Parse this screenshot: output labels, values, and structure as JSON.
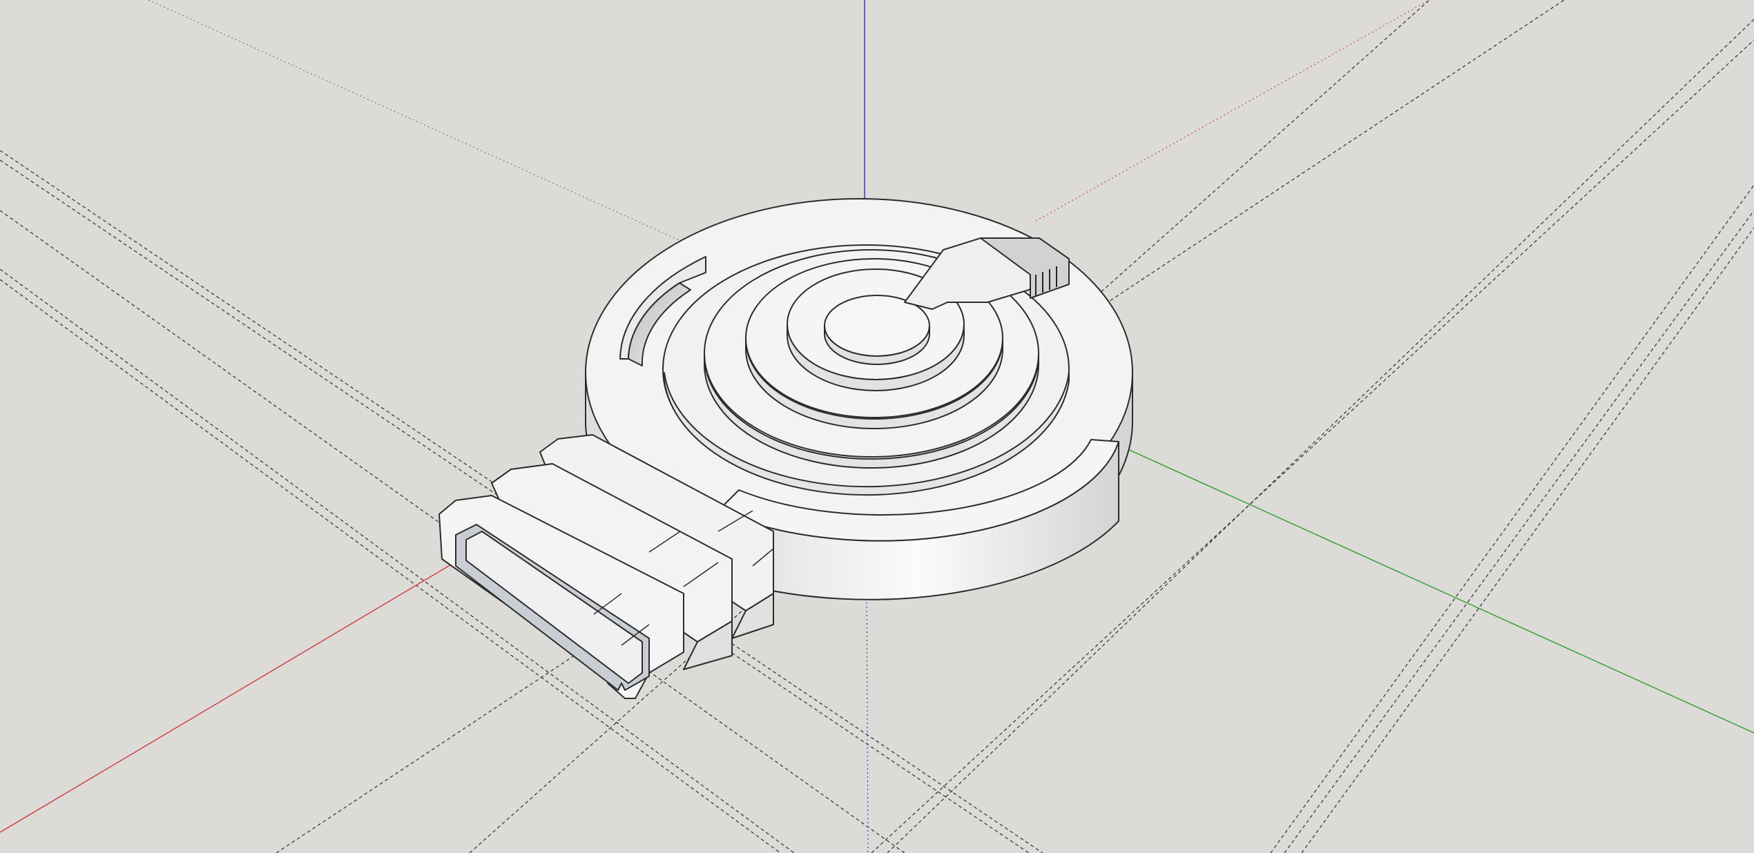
{
  "viewport": {
    "background": "#dcdbd7",
    "axes": {
      "red": "#d23a3a",
      "green": "#2f9e2f",
      "blue": "#2a2ad4"
    },
    "model_fill": "#f1f1f1",
    "model_side_fill": "#e6e6e6",
    "model_edge": "#2b2b2b",
    "guide_line_color": "#3a3a3a",
    "visible_text": []
  }
}
